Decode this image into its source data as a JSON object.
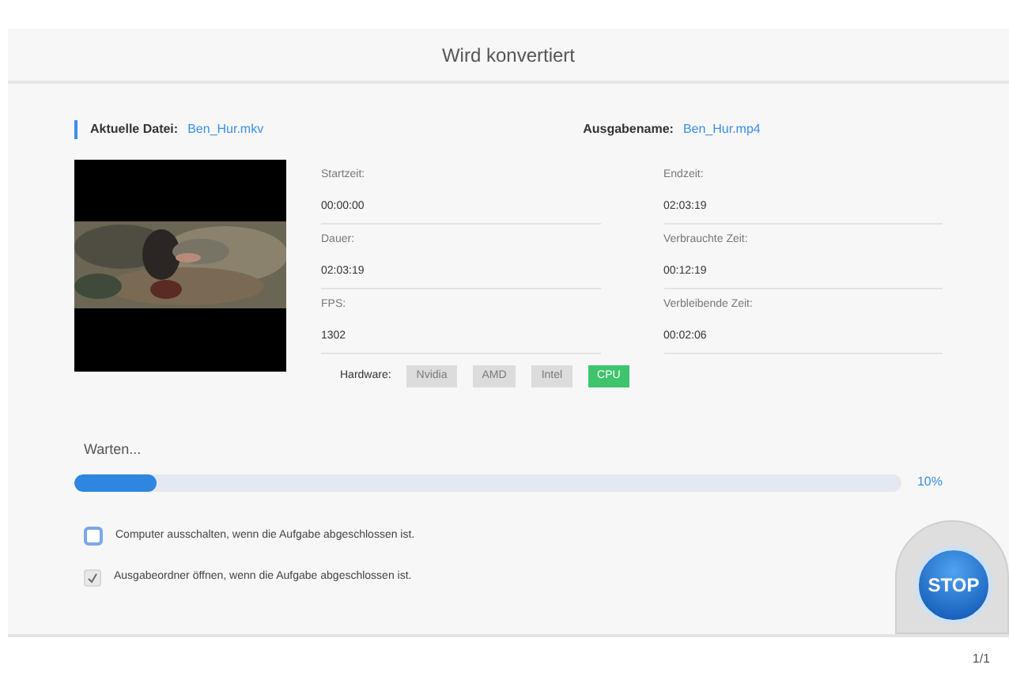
{
  "window": {
    "title": "Wird konvertiert"
  },
  "current_file": {
    "label": "Aktuelle Datei:",
    "value": "Ben_Hur.mkv"
  },
  "output_name": {
    "label": "Ausgabename:",
    "value": "Ben_Hur.mp4"
  },
  "fields": [
    {
      "label": "Startzeit:",
      "value": "00:00:00"
    },
    {
      "label": "Endzeit:",
      "value": "02:03:19"
    },
    {
      "label": "Dauer:",
      "value": "02:03:19"
    },
    {
      "label": "Verbrauchte Zeit:",
      "value": "00:12:19"
    },
    {
      "label": "FPS:",
      "value": "1302"
    },
    {
      "label": "Verbleibende Zeit:",
      "value": "00:02:06"
    }
  ],
  "hardware": {
    "label": "Hardware:",
    "options": [
      {
        "label": "Nvidia",
        "selected": false
      },
      {
        "label": "AMD",
        "selected": false
      },
      {
        "label": "Intel",
        "selected": false
      },
      {
        "label": "CPU",
        "selected": true
      }
    ]
  },
  "progress": {
    "status": "Warten...",
    "level": 0.1,
    "reading": "10%"
  },
  "options": [
    {
      "label": "Computer ausschalten, wenn die Aufgabe abgeschlossen ist.",
      "checked": false
    },
    {
      "label": "Ausgabeordner öffnen, wenn die Aufgabe abgeschlossen ist.",
      "checked": true
    }
  ],
  "stop_button": {
    "label": "STOP"
  },
  "status_bar": {
    "page": "1/1"
  }
}
